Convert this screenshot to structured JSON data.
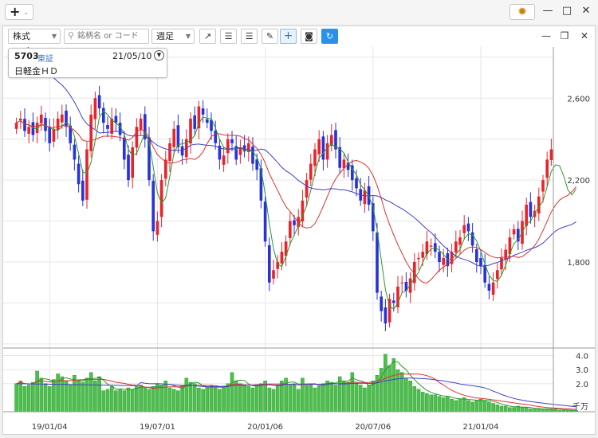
{
  "titlebar": {
    "add_glyph": "+",
    "add_chevron": "⌄",
    "gear_glyph": "✹"
  },
  "toolbar": {
    "type_select": "株式",
    "search_placeholder": "銘柄名 or コード",
    "period_select": "週足"
  },
  "stock": {
    "code": "5703",
    "market": "東証",
    "date": "21/05/10",
    "name": "日軽金ＨＤ"
  },
  "chart_data": {
    "type": "candlestick",
    "price_axis": {
      "ticks": [
        2600,
        2200,
        1800
      ],
      "tick_labels": [
        "2,600",
        "2,200",
        "1,800"
      ],
      "range": [
        1380,
        2850
      ]
    },
    "volume_axis": {
      "ticks": [
        4.0,
        3.0,
        2.0
      ],
      "tick_labels": [
        "4.0",
        "3.0",
        "2.0"
      ],
      "unit": "千万",
      "range": [
        0,
        4.2
      ]
    },
    "x_tick_labels": [
      "19/01/04",
      "19/07/01",
      "20/01/06",
      "20/07/06",
      "21/01/04"
    ],
    "x_tick_positions": [
      8,
      34,
      60,
      86,
      112
    ],
    "bars": 130,
    "up_color": "#e8242a",
    "down_color": "#2832d8",
    "volume_color": "#4cc04c",
    "ma_short_color": "#2a9a2a",
    "ma_mid_color": "#e03030",
    "ma_long_color": "#4040c8",
    "close": [
      2480,
      2500,
      2440,
      2460,
      2420,
      2480,
      2520,
      2440,
      2380,
      2450,
      2500,
      2520,
      2460,
      2380,
      2300,
      2180,
      2100,
      2350,
      2520,
      2600,
      2550,
      2480,
      2450,
      2500,
      2480,
      2420,
      2300,
      2200,
      2360,
      2460,
      2500,
      2400,
      2200,
      1950,
      2000,
      2200,
      2300,
      2380,
      2450,
      2360,
      2320,
      2400,
      2500,
      2450,
      2560,
      2520,
      2480,
      2440,
      2380,
      2300,
      2320,
      2400,
      2380,
      2300,
      2360,
      2340,
      2380,
      2280,
      2250,
      2100,
      1900,
      1700,
      1760,
      1800,
      1850,
      1900,
      2000,
      1980,
      2020,
      2100,
      2200,
      2280,
      2350,
      2400,
      2300,
      2380,
      2420,
      2350,
      2260,
      2300,
      2250,
      2200,
      2160,
      2100,
      2150,
      2080,
      1950,
      1650,
      1560,
      1500,
      1620,
      1600,
      1680,
      1700,
      1660,
      1720,
      1800,
      1820,
      1850,
      1900,
      1880,
      1850,
      1800,
      1820,
      1780,
      1850,
      1900,
      1920,
      1980,
      1950,
      1880,
      1800,
      1780,
      1700,
      1660,
      1700,
      1760,
      1820,
      1860,
      1920,
      1960,
      1900,
      2000,
      2080,
      2020,
      2050,
      2120,
      2200,
      2300,
      2350,
      2250,
      2180,
      2100,
      2080,
      2150,
      2300
    ],
    "volume": [
      2.0,
      2.2,
      1.8,
      1.9,
      2.1,
      2.9,
      2.4,
      2.0,
      1.8,
      2.3,
      2.7,
      2.5,
      2.2,
      1.9,
      2.6,
      2.2,
      2.1,
      2.4,
      2.8,
      2.2,
      2.5,
      1.5,
      1.6,
      1.8,
      1.5,
      1.6,
      1.5,
      1.7,
      1.6,
      1.8,
      1.9,
      1.7,
      1.6,
      1.8,
      2.0,
      1.9,
      2.2,
      1.7,
      1.6,
      1.5,
      1.9,
      2.4,
      2.1,
      2.0,
      1.7,
      1.6,
      1.8,
      1.9,
      1.7,
      1.6,
      1.8,
      2.0,
      2.8,
      2.2,
      2.0,
      1.9,
      1.8,
      1.7,
      1.9,
      2.0,
      2.2,
      1.7,
      1.6,
      1.9,
      2.2,
      2.4,
      1.9,
      2.0,
      1.6,
      2.4,
      1.9,
      2.0,
      1.7,
      1.8,
      2.0,
      2.2,
      2.1,
      1.9,
      2.5,
      2.2,
      2.1,
      2.8,
      2.0,
      1.9,
      1.7,
      1.9,
      2.2,
      2.6,
      3.1,
      4.1,
      3.3,
      3.8,
      3.0,
      2.8,
      2.4,
      2.2,
      1.8,
      1.6,
      1.4,
      1.3,
      1.2,
      1.2,
      1.1,
      1.0,
      1.1,
      0.9,
      0.8,
      0.9,
      1.0,
      0.8,
      0.7,
      0.8,
      0.9,
      0.8,
      0.7,
      0.6,
      0.5,
      0.4,
      0.4,
      0.3,
      0.3,
      0.4,
      0.3,
      0.3,
      0.2,
      0.2,
      0.2,
      0.2,
      0.2,
      0.2,
      0.2,
      0.1,
      0.1,
      0.1,
      0.1,
      0.1
    ]
  }
}
